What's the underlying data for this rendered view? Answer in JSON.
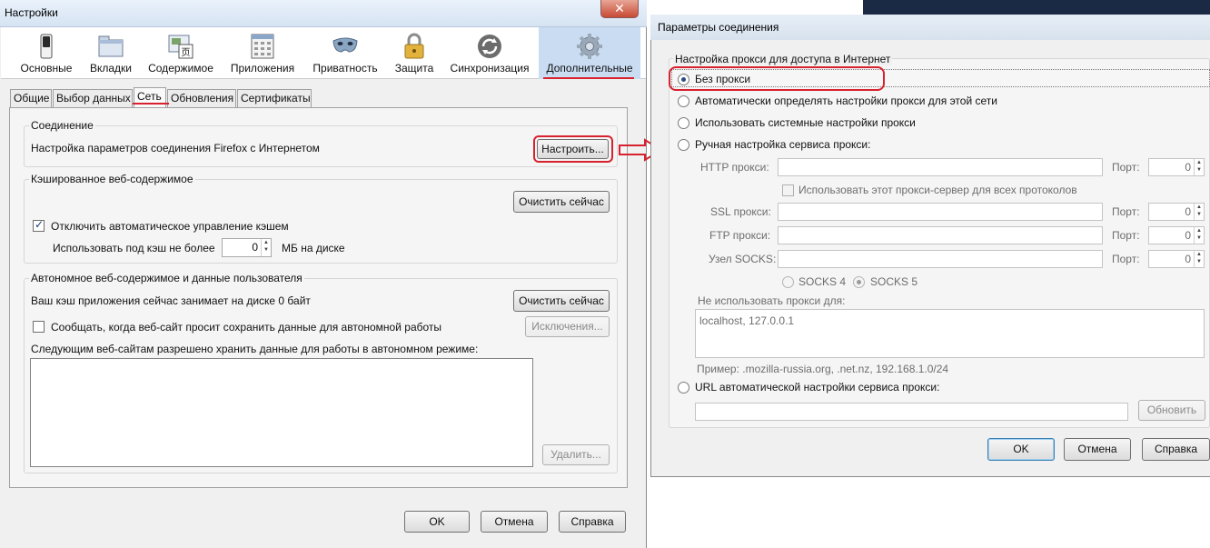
{
  "left_window": {
    "title": "Настройки",
    "close": "✕",
    "panes": [
      {
        "label": "Основные",
        "icon": "switch-icon"
      },
      {
        "label": "Вкладки",
        "icon": "tabs-icon"
      },
      {
        "label": "Содержимое",
        "icon": "content-icon"
      },
      {
        "label": "Приложения",
        "icon": "applications-icon"
      },
      {
        "label": "Приватность",
        "icon": "mask-icon"
      },
      {
        "label": "Защита",
        "icon": "lock-icon"
      },
      {
        "label": "Синхронизация",
        "icon": "sync-icon"
      },
      {
        "label": "Дополнительные",
        "icon": "gear-icon",
        "selected": true
      }
    ],
    "tabs": [
      {
        "label": "Общие"
      },
      {
        "label": "Выбор данных"
      },
      {
        "label": "Сеть",
        "active": true
      },
      {
        "label": "Обновления"
      },
      {
        "label": "Сертификаты"
      }
    ],
    "connection": {
      "title": "Соединение",
      "description": "Настройка параметров соединения Firefox с Интернетом",
      "button": "Настроить..."
    },
    "cache": {
      "title": "Кэшированное веб-содержимое",
      "clear_button": "Очистить сейчас",
      "override_checkbox": "Отключить автоматическое управление кэшем",
      "override_checked": true,
      "limit_label": "Использовать под кэш не более",
      "limit_value": "0",
      "limit_unit": "МБ на диске"
    },
    "offline": {
      "title": "Автономное веб-содержимое и данные пользователя",
      "usage_text": "Ваш кэш приложения сейчас занимает на диске 0 байт",
      "clear_button": "Очистить сейчас",
      "notify_checkbox": "Сообщать, когда веб-сайт просит сохранить данные для автономной работы",
      "notify_checked": false,
      "exceptions_button": "Исключения...",
      "list_label": "Следующим веб-сайтам разрешено хранить данные для работы в автономном режиме:",
      "remove_button": "Удалить..."
    },
    "footer": {
      "ok": "OK",
      "cancel": "Отмена",
      "help": "Справка"
    },
    "arrow_color": "#d7212e"
  },
  "right_window": {
    "title": "Параметры соединения",
    "group_title": "Настройка прокси для доступа в Интернет",
    "options": {
      "no_proxy": "Без прокси",
      "auto_detect": "Автоматически определять настройки прокси для этой сети",
      "system": "Использовать системные настройки прокси",
      "manual": "Ручная настройка сервиса прокси:",
      "pac_url": "URL автоматической настройки сервиса прокси:"
    },
    "selected_option": "no_proxy",
    "manual": {
      "http_label": "HTTP прокси:",
      "port_label": "Порт:",
      "http_port": "0",
      "same_for_all": "Использовать этот прокси-сервер для всех протоколов",
      "ssl_label": "SSL прокси:",
      "ssl_port": "0",
      "ftp_label": "FTP прокси:",
      "ftp_port": "0",
      "socks_label": "Узел SOCKS:",
      "socks_port": "0",
      "socks4": "SOCKS 4",
      "socks5": "SOCKS 5",
      "no_proxy_label": "Не использовать прокси для:",
      "no_proxy_value": "localhost, 127.0.0.1",
      "example": "Пример: .mozilla-russia.org, .net.nz, 192.168.1.0/24"
    },
    "reload_button": "Обновить",
    "footer": {
      "ok": "OK",
      "cancel": "Отмена",
      "help": "Справка"
    }
  }
}
